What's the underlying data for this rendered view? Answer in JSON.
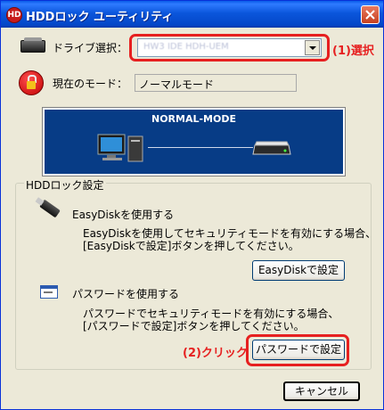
{
  "window": {
    "title": "HDDロック ユーティリティ",
    "app_icon_text": "HD"
  },
  "drive": {
    "label": "ドライブ選択：",
    "selected": "HW3 IDE HDH-UEM",
    "annotation": "(1)選択"
  },
  "mode": {
    "label": "現在のモード：",
    "value": "ノーマルモード"
  },
  "banner": {
    "title": "NORMAL-MODE"
  },
  "group": {
    "legend": "HDDロック設定",
    "easydisk": {
      "heading": "EasyDiskを使用する",
      "desc1": "EasyDiskを使用してセキュリティモードを有効にする場合、",
      "desc2": "[EasyDiskで設定]ボタンを押してください。",
      "button": "EasyDiskで設定"
    },
    "password": {
      "heading": "パスワードを使用する",
      "desc1": "パスワードでセキュリティモードを有効にする場合、",
      "desc2": "[パスワードで設定]ボタンを押してください。",
      "button": "パスワードで設定",
      "annotation": "(2)クリック"
    }
  },
  "footer": {
    "cancel": "キャンセル"
  },
  "colors": {
    "annotation": "#e62020",
    "titlebar": "#0a5ce8",
    "banner": "#073c86"
  }
}
